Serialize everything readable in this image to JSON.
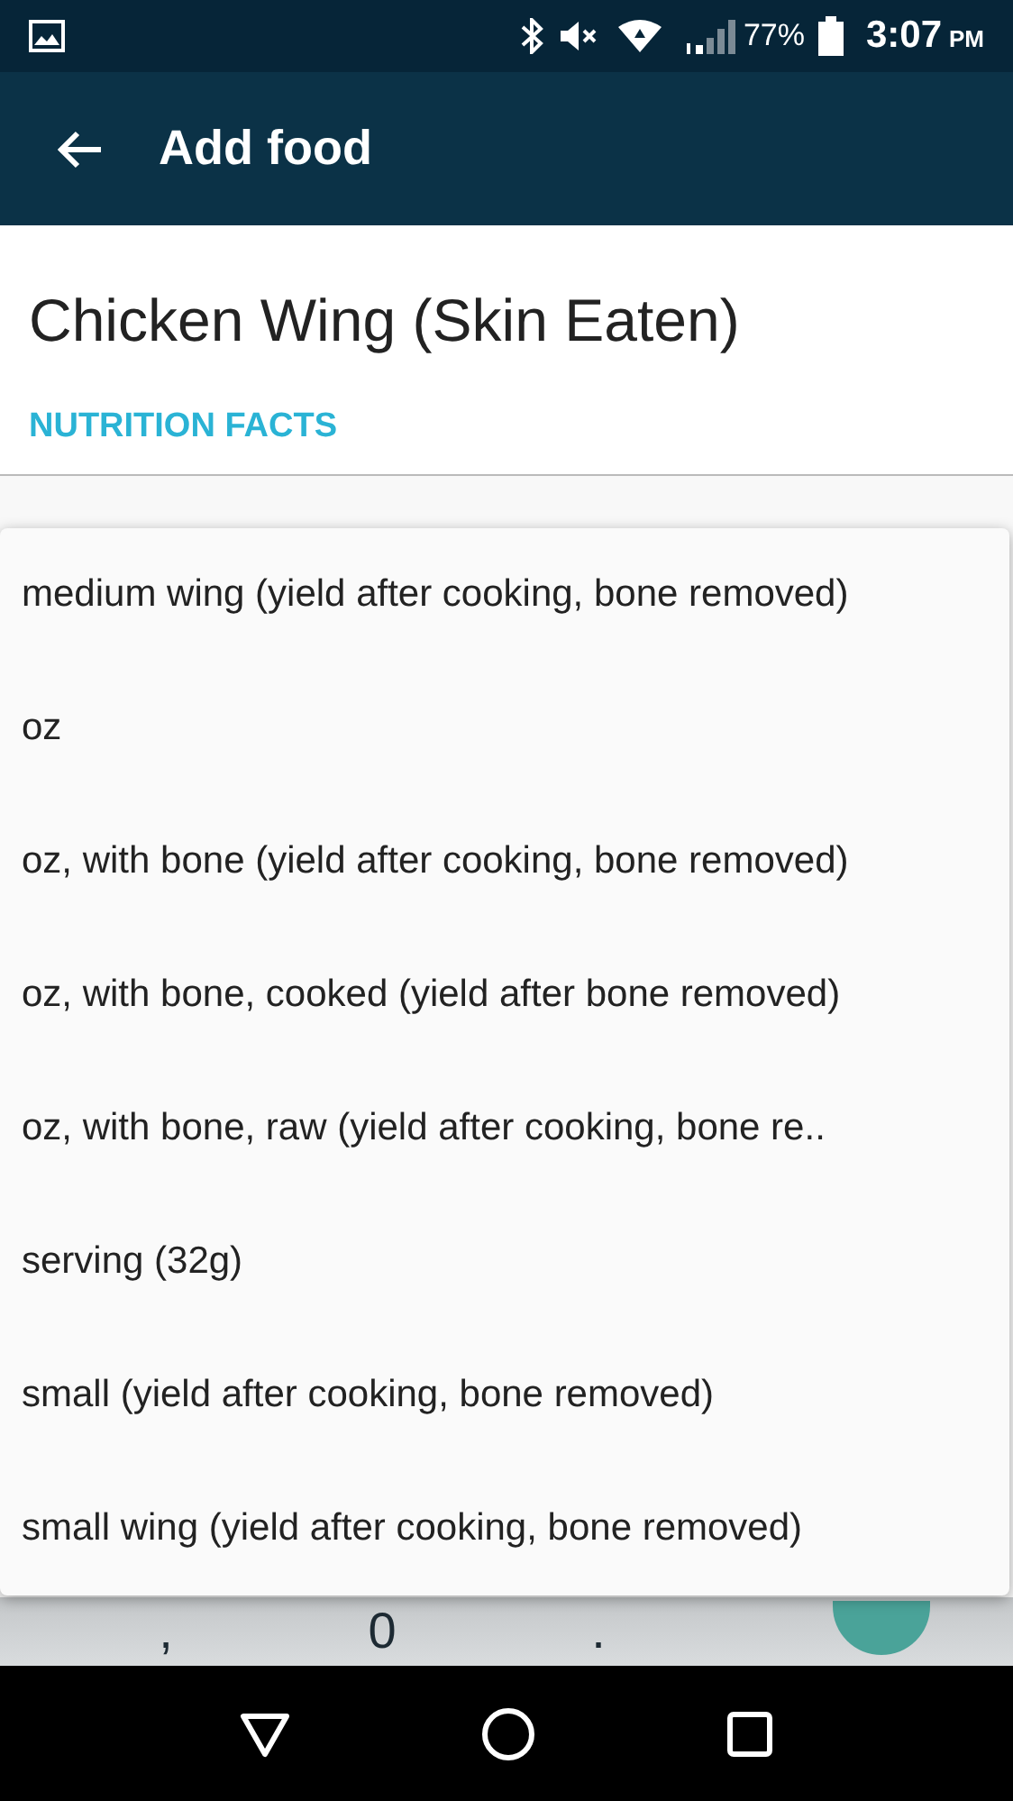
{
  "status_bar": {
    "battery": "77%",
    "time": "3:07",
    "ampm": "PM"
  },
  "app_bar": {
    "title": "Add food"
  },
  "food": {
    "name": "Chicken Wing (Skin Eaten)",
    "section_label": "NUTRITION FACTS"
  },
  "keyboard": {
    "keys": [
      ",",
      "0",
      "."
    ]
  },
  "menu": {
    "items": [
      {
        "label": "medium wing (yield after cooking, bone removed)"
      },
      {
        "label": "oz"
      },
      {
        "label": "oz, with bone (yield after cooking, bone removed)"
      },
      {
        "label": "oz, with bone, cooked (yield after bone removed)"
      },
      {
        "label": "oz, with bone, raw (yield after cooking, bone re.."
      },
      {
        "label": "serving (32g)"
      },
      {
        "label": "small (yield after cooking, bone removed)"
      },
      {
        "label": "small wing (yield after cooking, bone removed)"
      }
    ]
  }
}
